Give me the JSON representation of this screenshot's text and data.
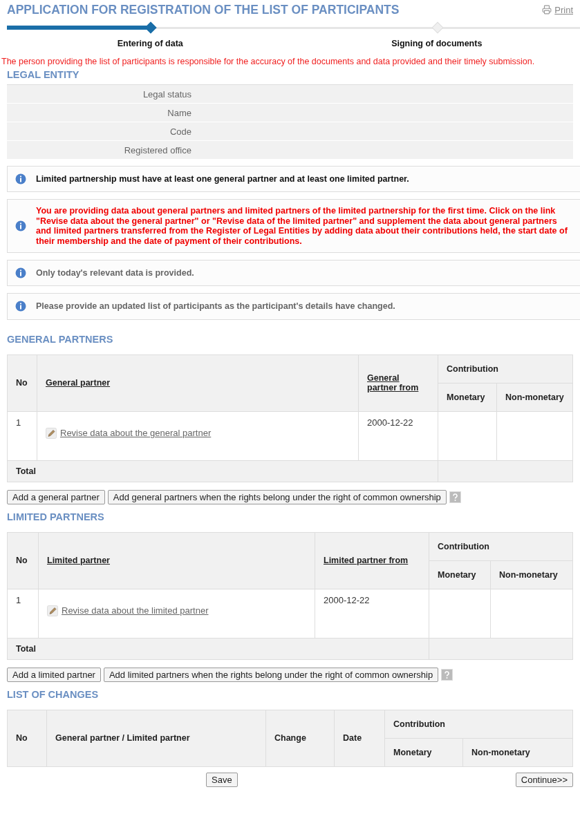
{
  "header": {
    "title": "APPLICATION FOR REGISTRATION OF THE LIST OF PARTICIPANTS",
    "print_link": "Print"
  },
  "steps": [
    {
      "label": "Entering of data",
      "selected": true
    },
    {
      "label": "Signing of documents",
      "selected": false
    }
  ],
  "notice": "The person providing the list of participants is responsible for the accuracy of the documents and data provided and their timely submission.",
  "legal_entity": {
    "heading": "LEGAL ENTITY",
    "fields": [
      "Legal status",
      "Name",
      "Code",
      "Registered office"
    ]
  },
  "info_messages": [
    {
      "kind": "info",
      "text": "Limited partnership must have at least one general partner and at least one limited partner."
    },
    {
      "kind": "warning",
      "text": "You are providing data about general partners and limited partners of the limited partnership for the first time. Click on the link \"Revise data about the general partner\" or \"Revise data of the limited partner\" and supplement the data about general partners and limited partners transferred from the Register of Legal Entities by adding data about their contributions held, the start date of their membership and the date of payment of their contributions."
    },
    {
      "kind": "note",
      "text": "Only today's relevant data is provided."
    },
    {
      "kind": "note",
      "text": "Please provide an updated list of participants as the participant's details have changed."
    }
  ],
  "general_partners": {
    "heading": "GENERAL PARTNERS",
    "columns": {
      "no": "No",
      "partner": "General partner",
      "from": "General partner from",
      "contribution": "Contribution",
      "monetary": "Monetary",
      "non_monetary": "Non-monetary"
    },
    "rows": [
      {
        "no": "1",
        "link": "Revise data about the general partner",
        "from": "2000-12-22"
      }
    ],
    "total_label": "Total",
    "buttons": [
      "Add a general partner",
      "Add general partners when the rights belong under the right of common ownership"
    ]
  },
  "limited_partners": {
    "heading": "LIMITED PARTNERS",
    "columns": {
      "no": "No",
      "partner": "Limited partner",
      "from": "Limited partner from",
      "contribution": "Contribution",
      "monetary": "Monetary",
      "non_monetary": "Non-monetary"
    },
    "rows": [
      {
        "no": "1",
        "link": "Revise data about the limited partner",
        "from": "2000-12-22"
      }
    ],
    "total_label": "Total",
    "buttons": [
      "Add a limited partner",
      "Add limited partners when the rights belong under the right of common ownership"
    ]
  },
  "list_of_changes": {
    "heading": "LIST OF CHANGES",
    "columns": {
      "no": "No",
      "partner": "General partner / Limited partner",
      "change": "Change",
      "date": "Date",
      "contribution": "Contribution",
      "monetary": "Monetary",
      "non_monetary": "Non-monetary"
    }
  },
  "footer_buttons": {
    "save": "Save",
    "continue": "Continue>>"
  }
}
